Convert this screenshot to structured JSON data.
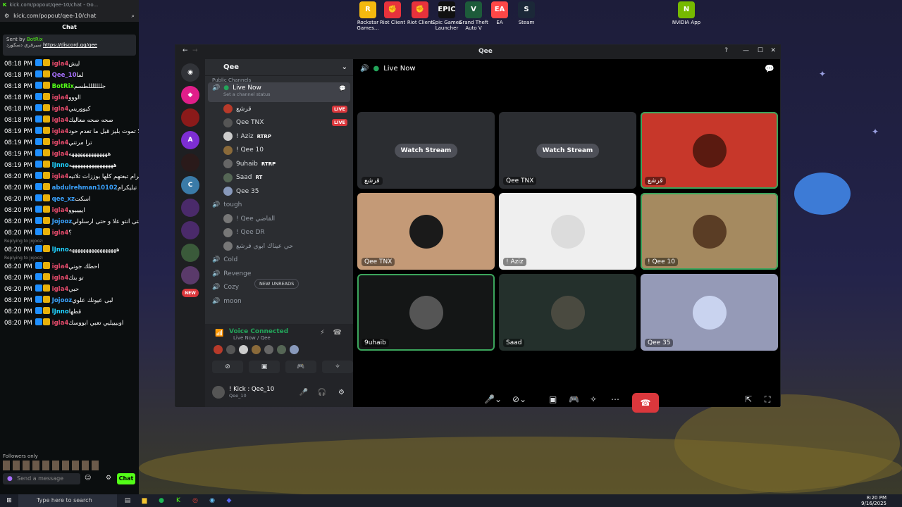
{
  "desktop": {
    "icons": [
      {
        "label": "Rockstar Games...",
        "color": "#f5b90f",
        "text": "R"
      },
      {
        "label": "Riot Client",
        "color": "#e8323c",
        "text": "✊"
      },
      {
        "label": "Riot Client",
        "color": "#e8323c",
        "text": "✊"
      },
      {
        "label": "Epic Games Launcher",
        "color": "#111111",
        "text": "EPIC"
      },
      {
        "label": "Grand Theft Auto V",
        "color": "#1d5b3a",
        "text": "V"
      },
      {
        "label": "EA",
        "color": "#ff4747",
        "text": "EA"
      },
      {
        "label": "Steam",
        "color": "#1b2838",
        "text": "S"
      },
      {
        "label": "NVIDIA App",
        "color": "#76b900",
        "text": "N"
      }
    ]
  },
  "kick": {
    "browser_tab": "kick.com/popout/qee-10/chat - Go...",
    "url": "kick.com/popout/qee-10/chat",
    "title": "Chat",
    "pinned": {
      "sent_by": "Sent by",
      "bot": "BotRix",
      "text": "سيرفري دسكورد",
      "link": "https://discord.gg/qee"
    },
    "messages": [
      {
        "time": "08:18 PM",
        "user": "igla4",
        "color": "#e74b6c",
        "text": "ليش"
      },
      {
        "time": "08:18 PM",
        "user": "Qee_10",
        "color": "#a970ff",
        "text": "لما"
      },
      {
        "time": "08:18 PM",
        "user": "BotRix",
        "color": "#53fc18",
        "text": "جلللللللطسم"
      },
      {
        "time": "08:18 PM",
        "user": "igla4",
        "color": "#e74b6c",
        "text": "الووو"
      },
      {
        "time": "08:18 PM",
        "user": "igla4",
        "color": "#e74b6c",
        "text": "كيووريني"
      },
      {
        "time": "08:18 PM",
        "user": "igla4",
        "color": "#e74b6c",
        "text": "صحه صحه معاليك"
      },
      {
        "time": "08:19 PM",
        "user": "igla4",
        "color": "#e74b6c",
        "text": "لا تموت بليز قبل ما تعدم حود"
      },
      {
        "time": "08:19 PM",
        "user": "igla4",
        "color": "#e74b6c",
        "text": "ترا مرتني"
      },
      {
        "time": "08:19 PM",
        "user": "igla4",
        "color": "#e74b6c",
        "text": "ههههههههههههههه"
      },
      {
        "time": "08:19 PM",
        "user": "lJnno",
        "color": "#1fd1ff",
        "text": "ههههههههههههههههه"
      },
      {
        "time": "08:20 PM",
        "user": "igla4",
        "color": "#e74b6c",
        "text": "ترا القطريه حسابات الانستقرام تبعتهم كلها بوززات تلاتيه"
      },
      {
        "time": "08:20 PM",
        "user": "abdulrehman10102",
        "color": "#3ba3ff",
        "text": "تبليكرام"
      },
      {
        "time": "08:20 PM",
        "user": "qee_xz",
        "color": "#3ba3ff",
        "text": "اسكت"
      },
      {
        "time": "08:20 PM",
        "user": "igla4",
        "color": "#e74b6c",
        "text": "ايييييوو"
      },
      {
        "time": "08:20 PM",
        "user": "Jojooz",
        "color": "#3ba3ff",
        "text": "بلا حتى انتو علا و حتى ارسلولي"
      },
      {
        "time": "08:20 PM",
        "user": "igla4",
        "color": "#e74b6c",
        "text": "؟"
      },
      {
        "time": "08:20 PM",
        "user": "lJnno",
        "color": "#1fd1ff",
        "text": "هههههههههههههههههه",
        "reply": "Replying to Jojooz:"
      },
      {
        "time": "08:20 PM",
        "user": "igla4",
        "color": "#e74b6c",
        "text": "احطك جوني",
        "reply": "Replying to Jojooz:"
      },
      {
        "time": "08:20 PM",
        "user": "igla4",
        "color": "#e74b6c",
        "text": "تو بنك"
      },
      {
        "time": "08:20 PM",
        "user": "igla4",
        "color": "#e74b6c",
        "text": "حبي"
      },
      {
        "time": "08:20 PM",
        "user": "Jojooz",
        "color": "#3ba3ff",
        "text": "لبى عيونك علوي"
      },
      {
        "time": "08:20 PM",
        "user": "lJnno",
        "color": "#1fd1ff",
        "text": "قطها"
      },
      {
        "time": "08:20 PM",
        "user": "igla4",
        "color": "#e74b6c",
        "text": "اوبيييليي تعبي ابووسك"
      }
    ],
    "followers_only": "Followers only",
    "send_placeholder": "Send a message",
    "chat_button": "Chat"
  },
  "discord": {
    "window_title": "Qee",
    "server_name": "Qee",
    "category": "Public Channels",
    "active_channel": "Live Now",
    "channel_status": "Set a channel status",
    "voice_users": [
      {
        "name": "قرشع",
        "live": "LIVE",
        "color": "#b83a2a"
      },
      {
        "name": "Qee TNX",
        "live": "LIVE",
        "color": "#555"
      },
      {
        "name": "! Aziz",
        "tag": "RTRP",
        "color": "#ccc"
      },
      {
        "name": "! Qee 10",
        "color": "#8a6a3a"
      },
      {
        "name": "9uhaib",
        "tag": "RTRP",
        "color": "#666"
      },
      {
        "name": "Saad",
        "tag": "RT",
        "color": "#556655"
      },
      {
        "name": "Qee 35",
        "color": "#8899bb"
      }
    ],
    "other_channels": [
      {
        "name": "tough",
        "users": [
          "! Qee القاضي",
          "! Qee DR",
          "حي عيناك ابوي قرشع"
        ]
      },
      {
        "name": "Cold"
      },
      {
        "name": "Revenge"
      },
      {
        "name": "Cozy"
      },
      {
        "name": "moon"
      }
    ],
    "new_unreads": "NEW UNREADS",
    "new_badge": "NEW",
    "voice_connected": "Voice Connected",
    "voice_location": "Live Now / Qee",
    "user_name": "! Kick : Qee_10",
    "user_sub": "Qee_10",
    "stage_title": "Live Now",
    "watch_stream": "Watch Stream",
    "tiles": [
      {
        "name": "قرشع",
        "bg": "#2b2d31",
        "watch": true
      },
      {
        "name": "Qee TNX",
        "bg": "#2b2d31",
        "watch": true
      },
      {
        "name": "قرشع",
        "bg": "#c7372a",
        "pic": "#5a1a10",
        "border": "#3ba55c"
      },
      {
        "name": "Qee TNX",
        "bg": "#c49a77",
        "pic": "#1a1a1a"
      },
      {
        "name": "! Aziz",
        "bg": "#efefef",
        "pic": "#dcdcdc"
      },
      {
        "name": "! Qee 10",
        "bg": "#a58a60",
        "pic": "#5a3d25",
        "border": "#3ba55c"
      },
      {
        "name": "9uhaib",
        "bg": "#141616",
        "pic": "#555",
        "border": "#3ba55c"
      },
      {
        "name": "Saad",
        "bg": "#24302c",
        "pic": "#4a4a40"
      },
      {
        "name": "Qee 35",
        "bg": "#959ab7",
        "pic": "#c9d3ef"
      }
    ]
  },
  "taskbar": {
    "search": "Type here to search",
    "time": "8:20 PM",
    "date": "9/16/2025"
  }
}
